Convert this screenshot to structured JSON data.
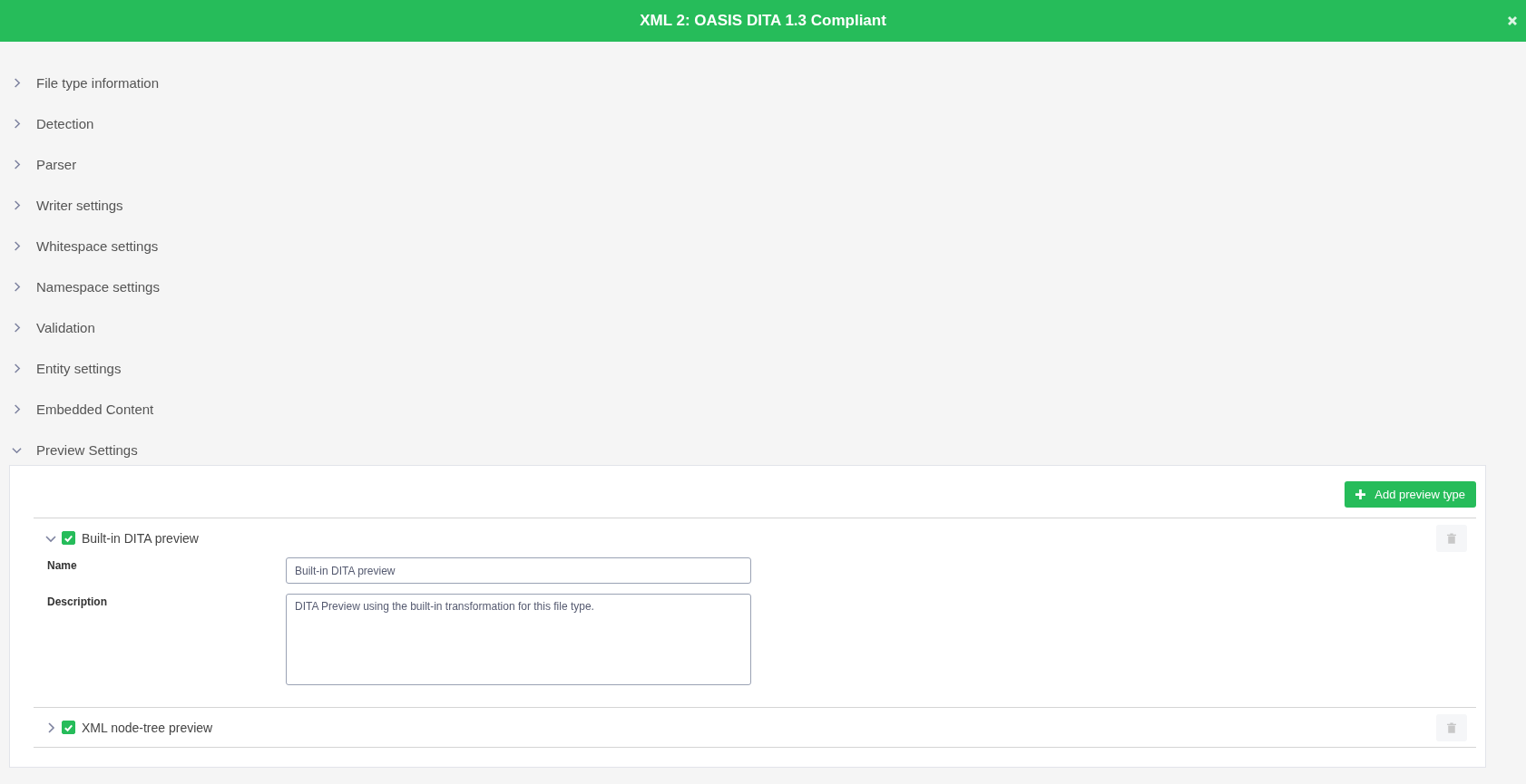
{
  "window": {
    "title": "XML 2: OASIS DITA 1.3 Compliant"
  },
  "sections": [
    {
      "label": "File type information",
      "expanded": false
    },
    {
      "label": "Detection",
      "expanded": false
    },
    {
      "label": "Parser",
      "expanded": false
    },
    {
      "label": "Writer settings",
      "expanded": false
    },
    {
      "label": "Whitespace settings",
      "expanded": false
    },
    {
      "label": "Namespace settings",
      "expanded": false
    },
    {
      "label": "Validation",
      "expanded": false
    },
    {
      "label": "Entity settings",
      "expanded": false
    },
    {
      "label": "Embedded Content",
      "expanded": false
    },
    {
      "label": "Preview Settings",
      "expanded": true,
      "add_button": "Add preview type",
      "preview_types": [
        {
          "label": "Built-in DITA preview",
          "expanded": true,
          "checked": true,
          "fields": [
            {
              "label": "Name",
              "kind": "input",
              "value": "Built-in DITA preview"
            },
            {
              "label": "Description",
              "kind": "textarea",
              "value": "DITA Preview using the built-in transformation for this file type."
            }
          ]
        },
        {
          "label": "XML node-tree preview",
          "expanded": false,
          "checked": true
        }
      ]
    }
  ]
}
